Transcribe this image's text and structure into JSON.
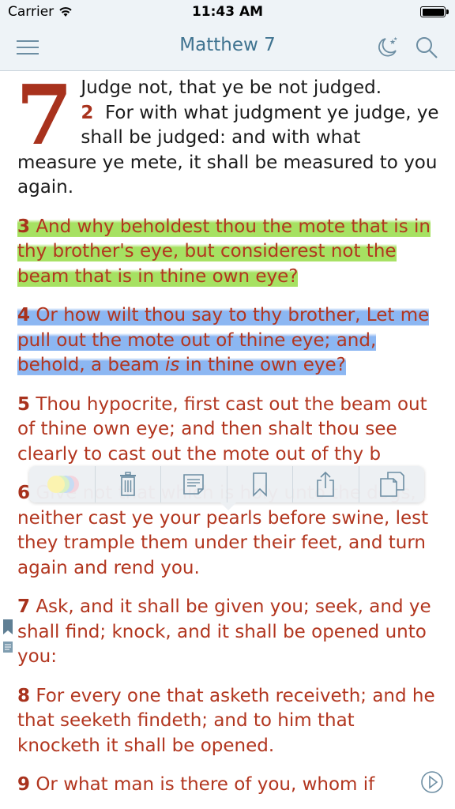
{
  "status_bar": {
    "carrier": "Carrier",
    "time": "11:43 AM"
  },
  "nav": {
    "title": "Matthew 7",
    "icons": [
      "menu-icon",
      "night-mode-icon",
      "search-icon"
    ]
  },
  "chapter": {
    "number": "7",
    "verses": [
      {
        "num": "",
        "text": "Judge not, that ye be not judged."
      },
      {
        "num": "2",
        "text": "For with what judgment ye judge, ye shall be judged: and with what measure ye mete, it shall be measured to you again."
      },
      {
        "num": "3",
        "text": "And why beholdest thou the mote that is in thy brother's eye, but considerest not the beam that is in thine own eye?",
        "highlight": "green"
      },
      {
        "num": "4",
        "text_a": "Or how wilt thou say to thy brother, Let me pull out the mote out of thine eye; and, behold, a beam",
        "text_em": "is",
        "text_b": "in thine own eye?",
        "highlight": "blue"
      },
      {
        "num": "5",
        "text": "Thou hypocrite, first cast out the beam out of thine own eye; and then shalt thou see clearly to cast out the mote out of thy b"
      },
      {
        "num": "6",
        "text": "Give not that which is holy unto the dogs, neither cast ye your pearls before swine, lest they trample them under their feet, and turn again and rend you."
      },
      {
        "num": "7",
        "text": "Ask, and it shall be given you; seek, and ye shall find; knock, and it shall be opened unto you:"
      },
      {
        "num": "8",
        "text": "For every one that asketh receiveth; and he that seeketh findeth; and to him that knocketh it shall be opened."
      },
      {
        "num": "9",
        "text": "Or what man is there of you, whom if"
      }
    ]
  },
  "toolbar": {
    "buttons": [
      "highlight-colors-icon",
      "delete-icon",
      "note-icon",
      "bookmark-icon",
      "share-icon",
      "copy-icon"
    ]
  },
  "colors": {
    "accent": "#3f7390",
    "verse_text": "#b2361f",
    "highlight_green": "#96dc46",
    "highlight_blue": "#78aaf0"
  }
}
